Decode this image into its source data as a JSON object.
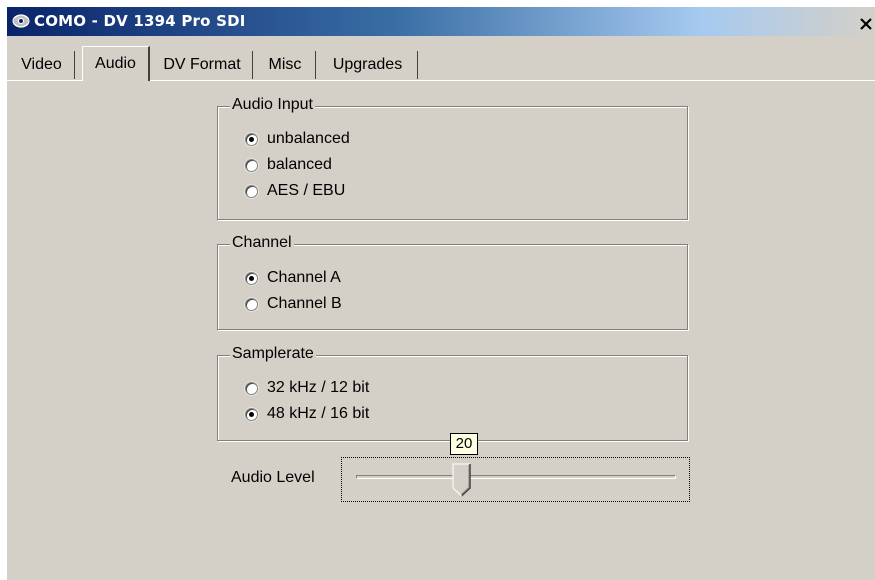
{
  "window": {
    "title": "COMO - DV 1394 Pro SDI",
    "close_glyph": "×",
    "icon": "app-logo-icon"
  },
  "tabs": [
    {
      "label": "Video",
      "active": false
    },
    {
      "label": "Audio",
      "active": true
    },
    {
      "label": "DV Format",
      "active": false
    },
    {
      "label": "Misc",
      "active": false
    },
    {
      "label": "Upgrades",
      "active": false
    }
  ],
  "audio_input": {
    "legend": "Audio Input",
    "options": [
      {
        "label": "unbalanced",
        "checked": true
      },
      {
        "label": "balanced",
        "checked": false
      },
      {
        "label": "AES / EBU",
        "checked": false
      }
    ]
  },
  "channel": {
    "legend": "Channel",
    "options": [
      {
        "label": "Channel A",
        "checked": true
      },
      {
        "label": "Channel B",
        "checked": false
      }
    ]
  },
  "samplerate": {
    "legend": "Samplerate",
    "options": [
      {
        "label": "32 kHz / 12 bit",
        "checked": false
      },
      {
        "label": "48 kHz / 16 bit",
        "checked": true
      }
    ]
  },
  "audio_level": {
    "label": "Audio Level",
    "value": "20",
    "position_fraction": 0.33
  },
  "colors": {
    "title_bar_start": "#0a246a",
    "title_bar_end": "#d4d0c8",
    "face": "#d4d0c8",
    "tooltip_bg": "#ffffe1"
  }
}
